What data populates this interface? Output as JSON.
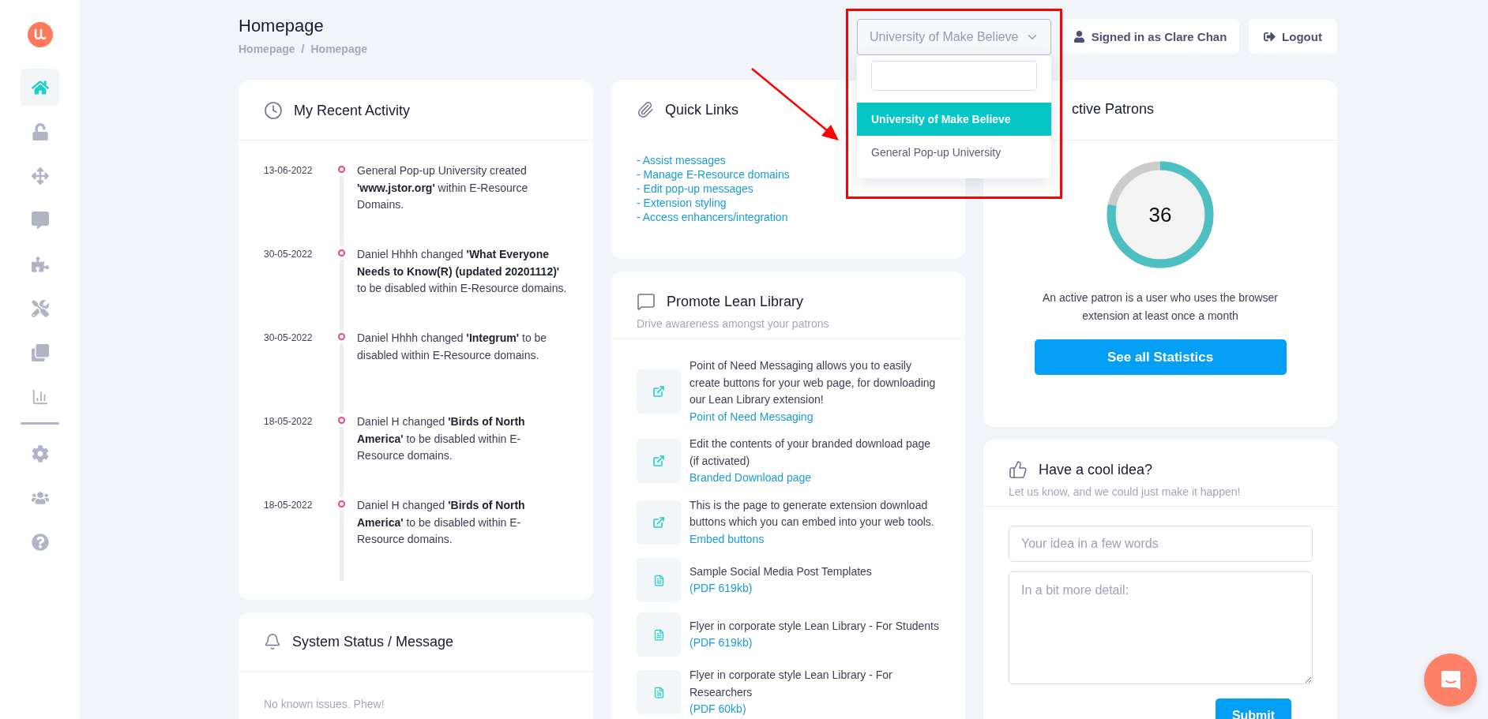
{
  "sidebar": {
    "items": [
      {
        "selected": true
      },
      {
        "selected": false
      },
      {
        "selected": false
      },
      {
        "selected": false
      },
      {
        "selected": false
      },
      {
        "selected": false
      },
      {
        "selected": false
      },
      {
        "selected": false
      },
      {
        "selected": false
      },
      {
        "selected": false
      },
      {
        "selected": false
      }
    ]
  },
  "header": {
    "title": "Homepage",
    "breadcrumb": [
      "Homepage",
      "/",
      "Homepage"
    ],
    "signed_in": "Signed in as Clare Chan",
    "logout": "Logout"
  },
  "institution_select": {
    "value": "University of Make Believe",
    "expanded": true,
    "options": [
      {
        "label": "University of Make Believe",
        "selected": true
      },
      {
        "label": "General Pop-up University",
        "selected": false
      }
    ]
  },
  "recent_activity": {
    "title": "My Recent Activity",
    "items": [
      {
        "date": "13-06-2022",
        "text": "General Pop-up University created **'www.jstor.org'** within E-Resource Domains."
      },
      {
        "date": "30-05-2022",
        "text": "Daniel Hhhh changed **'What Everyone Needs to Know(R) (updated 20201112)'** to be disabled within E-Resource domains."
      },
      {
        "date": "30-05-2022",
        "text": "Daniel Hhhh changed **'Integrum'** to be disabled within E-Resource domains."
      },
      {
        "date": "18-05-2022",
        "text": "Daniel H changed **'Birds of North America'** to be disabled within E-Resource domains."
      },
      {
        "date": "18-05-2022",
        "text": "Daniel H changed **'Birds of North America'** to be disabled within E-Resource domains."
      }
    ]
  },
  "system_status": {
    "title": "System Status / Message",
    "message": "No known issues. Phew!"
  },
  "quick_links": {
    "title": "Quick Links",
    "links": [
      "- Assist messages",
      "- Manage E-Resource domains",
      "- Edit pop-up messages",
      "- Extension styling",
      "- Access enhancers/integration"
    ]
  },
  "promote": {
    "title": "Promote Lean Library",
    "subtitle": "Drive awareness amongst your patrons",
    "items": [
      {
        "kind": "link",
        "text": "Point of Need Messaging allows you to easily create buttons for your web page, for downloading our Lean Library extension!",
        "link": "Point of Need Messaging"
      },
      {
        "kind": "link",
        "text": "Edit the contents of your branded download page (if activated)",
        "link": "Branded Download page"
      },
      {
        "kind": "link",
        "text": "This is the page to generate extension download buttons which you can embed into your web tools.",
        "link": "Embed buttons"
      },
      {
        "kind": "pdf",
        "text": "Sample Social Media Post Templates",
        "link": "(PDF 619kb)"
      },
      {
        "kind": "pdf",
        "text": "Flyer in corporate style Lean Library - For Students",
        "link": "(PDF 619kb)"
      },
      {
        "kind": "pdf",
        "text": "Flyer in corporate style Lean Library - For Researchers",
        "link": "(PDF 60kb)"
      }
    ]
  },
  "active_patrons": {
    "title": "ctive Patrons",
    "count": "36",
    "level": 0.78,
    "description": "An active patron is a user who uses the browser extension at least once a month",
    "button": "See all Statistics"
  },
  "idea": {
    "title": "Have a cool idea?",
    "subtitle": "Let us know, and we could just make it happen!",
    "short_placeholder": "Your idea in a few words",
    "detail_placeholder": "In a bit more detail:",
    "submit": "Submit"
  }
}
